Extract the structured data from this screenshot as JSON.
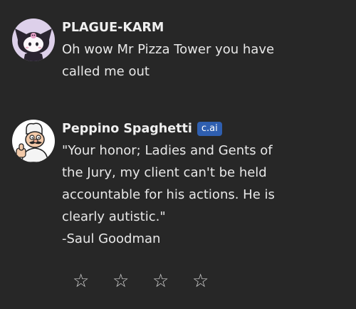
{
  "messages": [
    {
      "author": "PLAGUE-KARM",
      "text": "Oh wow Mr Pizza Tower you have\ncalled me out"
    },
    {
      "author": "Peppino Spaghetti",
      "badge": "c.ai",
      "text": "\"Your honor; Ladies and Gents of\nthe Jury, my client can't be held\naccountable for his actions. He is\nclearly autistic.\"\n-Saul Goodman"
    }
  ],
  "rating": {
    "stars": [
      "☆",
      "☆",
      "☆",
      "☆"
    ],
    "value": 0,
    "max": 4
  },
  "colors": {
    "background": "#272727",
    "badge": "#2f5fb0"
  },
  "icons": {
    "user_avatar": "kuromi-avatar-icon",
    "bot_avatar": "peppino-avatar-icon"
  }
}
